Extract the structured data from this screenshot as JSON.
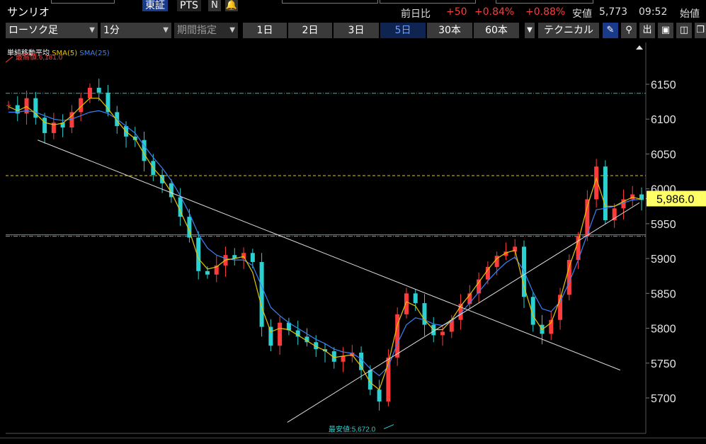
{
  "header": {
    "title": "サンリオ",
    "exchange_active": "東証",
    "exchange_pts": "PTS",
    "news_icon": "N",
    "alert_icon": "bell",
    "change_label": "前日比",
    "change_value": "+50",
    "change_pct1": "+0.84%",
    "change_pct2": "+0.88%",
    "low_label": "安値",
    "low_value": "5,773",
    "time": "09:52",
    "open_label": "始値",
    "colors": {
      "up": "#ff3b3b",
      "text": "#dddddd"
    }
  },
  "toolbar": {
    "chart_type": "ローソク足",
    "interval": "1分",
    "period": "期間指定",
    "tabs": [
      "1日",
      "2日",
      "3日",
      "5日",
      "30本",
      "60本"
    ],
    "active_tab": "5日",
    "technical": "テクニカル",
    "icons": [
      "pencil-icon",
      "zoom-icon",
      "output-icon",
      "area-chart-icon",
      "save-icon",
      "copy-icon"
    ]
  },
  "legend": {
    "title": "単純移動平均",
    "sma5": "SMA(5)",
    "sma25": "SMA(25)",
    "sma5_color": "#e8c400",
    "sma25_color": "#3b82f6"
  },
  "chart_data": {
    "type": "candlestick",
    "ylim": [
      5650,
      6200
    ],
    "y_ticks": [
      6150,
      6100,
      6050,
      6000,
      5950,
      5900,
      5850,
      5800,
      5750,
      5700
    ],
    "current_price": "5,986.0",
    "max_label": "最高値:6,181.0",
    "min_label": "最安値:5,672.0",
    "hlines": [
      {
        "value": 6137,
        "style": "dashdot",
        "color": "#2bb5b5"
      },
      {
        "value": 6019,
        "style": "dashed",
        "color": "#e8c400"
      },
      {
        "value": 5934,
        "style": "solid",
        "color": "#2bb5b5"
      },
      {
        "value": 5932,
        "style": "dashdot",
        "color": "#ff5a8a"
      }
    ],
    "close": [
      6120,
      6108,
      6130,
      6102,
      6080,
      6095,
      6088,
      6110,
      6130,
      6145,
      6138,
      6110,
      6090,
      6075,
      6070,
      6040,
      6020,
      6008,
      5988,
      5960,
      5930,
      5882,
      5877,
      5890,
      5905,
      5900,
      5908,
      5895,
      5802,
      5775,
      5808,
      5797,
      5788,
      5780,
      5770,
      5767,
      5752,
      5760,
      5765,
      5740,
      5712,
      5695,
      5758,
      5820,
      5850,
      5836,
      5805,
      5790,
      5795,
      5812,
      5835,
      5850,
      5870,
      5888,
      5904,
      5910,
      5917,
      5845,
      5805,
      5792,
      5812,
      5848,
      5898,
      5932,
      5985,
      6032,
      5955,
      5972,
      5985,
      5992,
      5984
    ],
    "sma5": [
      6118,
      6112,
      6118,
      6108,
      6095,
      6092,
      6094,
      6105,
      6118,
      6130,
      6130,
      6115,
      6098,
      6082,
      6072,
      6050,
      6030,
      6015,
      5995,
      5968,
      5940,
      5900,
      5885,
      5888,
      5898,
      5900,
      5903,
      5880,
      5830,
      5795,
      5800,
      5798,
      5790,
      5782,
      5774,
      5768,
      5758,
      5760,
      5762,
      5745,
      5722,
      5712,
      5750,
      5805,
      5838,
      5832,
      5812,
      5798,
      5798,
      5812,
      5832,
      5848,
      5866,
      5884,
      5900,
      5908,
      5912,
      5860,
      5818,
      5798,
      5808,
      5842,
      5888,
      5925,
      5975,
      6015,
      5975,
      5975,
      5982,
      5988,
      5985
    ],
    "sma25": [
      6110,
      6110,
      6112,
      6110,
      6105,
      6100,
      6098,
      6100,
      6105,
      6110,
      6112,
      6108,
      6100,
      6090,
      6080,
      6062,
      6045,
      6030,
      6012,
      5990,
      5965,
      5935,
      5915,
      5905,
      5900,
      5898,
      5898,
      5890,
      5860,
      5830,
      5818,
      5808,
      5800,
      5792,
      5784,
      5778,
      5770,
      5766,
      5764,
      5756,
      5742,
      5732,
      5745,
      5778,
      5805,
      5815,
      5812,
      5806,
      5804,
      5810,
      5822,
      5836,
      5852,
      5868,
      5882,
      5894,
      5902,
      5882,
      5852,
      5828,
      5824,
      5838,
      5866,
      5898,
      5935,
      5970,
      5972,
      5975,
      5980,
      5984,
      5985
    ],
    "trendlines": [
      {
        "from": [
          0.05,
          6070
        ],
        "to": [
          0.96,
          5740
        ]
      },
      {
        "from": [
          0.44,
          5665
        ],
        "to": [
          0.99,
          5980
        ]
      }
    ]
  }
}
